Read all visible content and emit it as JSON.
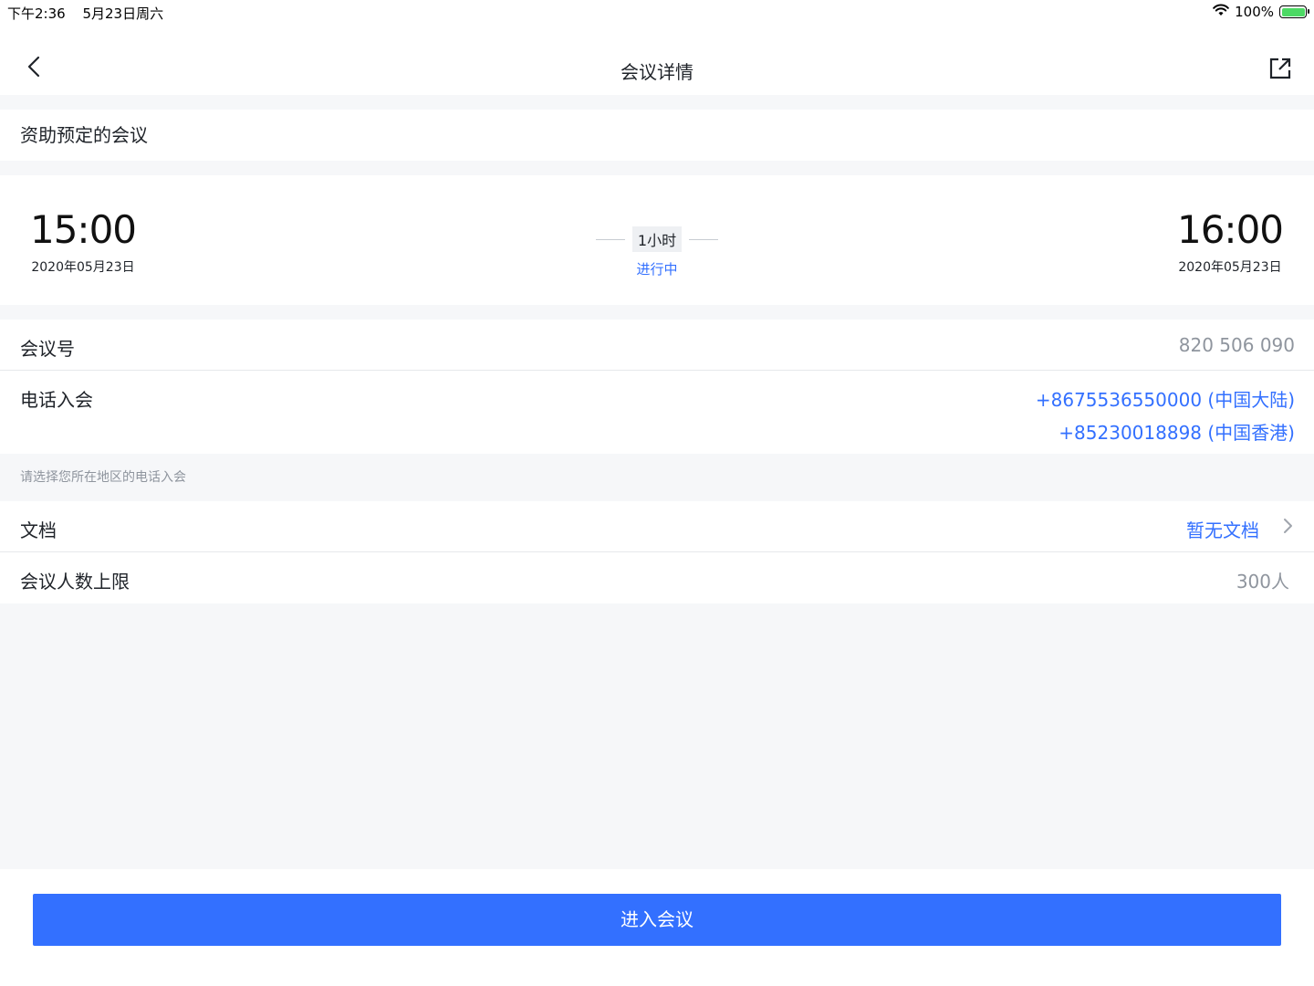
{
  "status_bar": {
    "time": "下午2:36",
    "date": "5月23日周六",
    "battery": "100%",
    "battery_level": 1.0,
    "icons": [
      "wifi-icon",
      "battery-icon"
    ]
  },
  "nav": {
    "title": "会议详情",
    "back_icon": "chevron-left-icon",
    "share_icon": "external-link-icon"
  },
  "meeting": {
    "title": "资助预定的会议",
    "start_time": "15:00",
    "start_date": "2020年05月23日",
    "end_time": "16:00",
    "end_date": "2020年05月23日",
    "duration": "1小时",
    "status": "进行中"
  },
  "info": {
    "meeting_id_label": "会议号",
    "meeting_id_value": "820 506 090",
    "phone_label": "电话入会",
    "phones": [
      "+8675536550000 (中国大陆)",
      "+85230018898 (中国香港)"
    ],
    "phone_hint": "请选择您所在地区的电话入会",
    "docs_label": "文档",
    "docs_value": "暂无文档",
    "limit_label": "会议人数上限",
    "limit_value": "300人"
  },
  "actions": {
    "enter_label": "进入会议"
  },
  "colors": {
    "accent": "#3370ff",
    "background": "#f6f7f9",
    "muted_text": "#8f959e"
  }
}
